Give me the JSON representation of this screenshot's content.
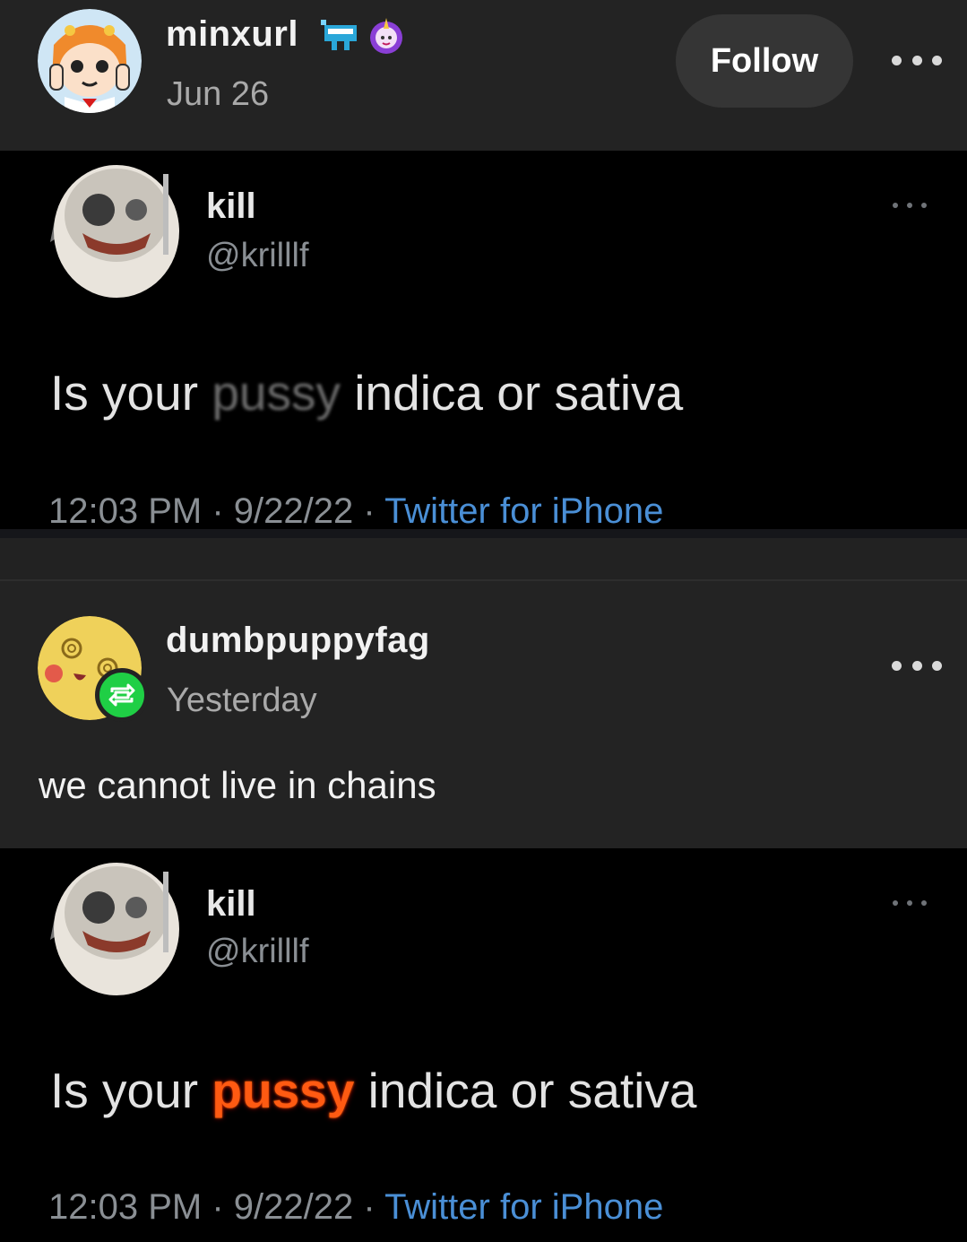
{
  "post1": {
    "username": "minxurl",
    "date": "Jun 26",
    "follow_label": "Follow",
    "more_icon": "ellipsis-icon",
    "badges": [
      "pixel-badge-icon",
      "unicorn-badge-icon"
    ]
  },
  "tweet1": {
    "name": "kill",
    "handle": "@krilllf",
    "text_before": "Is your ",
    "text_censored": "pussy",
    "text_after": " indica or sativa",
    "time": "12:03 PM",
    "date": "9/22/22",
    "client": "Twitter for iPhone"
  },
  "post2": {
    "username": "dumbpuppyfag",
    "date": "Yesterday",
    "body": "we cannot live in chains",
    "more_icon": "ellipsis-icon",
    "reblog_icon": "reblog-icon"
  },
  "tweet2": {
    "name": "kill",
    "handle": "@krilllf",
    "text_before": "Is your ",
    "text_fire": "pussy",
    "text_after": " indica or sativa",
    "time": "12:03 PM",
    "date": "9/22/22",
    "client": "Twitter for iPhone"
  },
  "colors": {
    "background": "#222222",
    "tweet_bg": "#000000",
    "reblog_green": "#1fcf45",
    "link_blue": "#4a8fd6"
  }
}
